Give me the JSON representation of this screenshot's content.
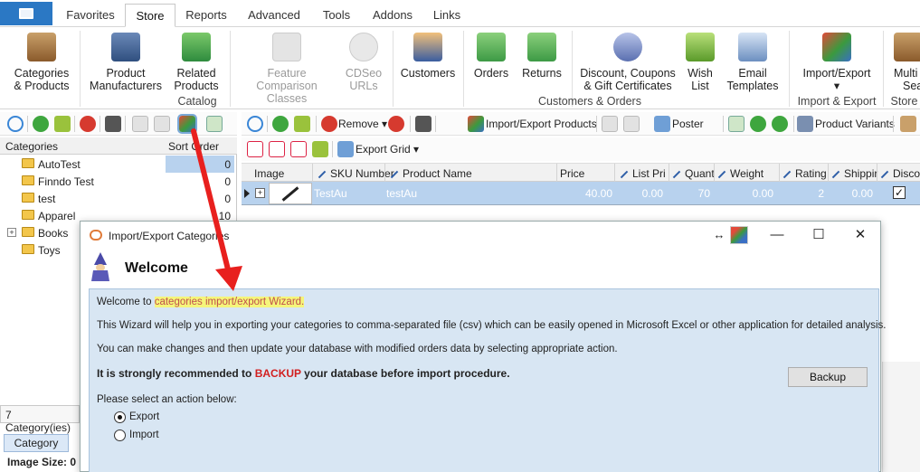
{
  "menu_tabs": [
    "Favorites",
    "Store",
    "Reports",
    "Advanced",
    "Tools",
    "Addons",
    "Links"
  ],
  "active_tab": "Store",
  "ribbon": {
    "buttons": [
      {
        "label1": "Categories",
        "label2": "& Products",
        "icon": "categories-products-icon",
        "enabled": true
      },
      {
        "label1": "Product",
        "label2": "Manufacturers",
        "icon": "manufacturers-icon",
        "enabled": true
      },
      {
        "label1": "Related",
        "label2": "Products",
        "icon": "related-products-icon",
        "enabled": true
      },
      {
        "label1": "Feature",
        "label2": "Comparison Classes",
        "icon": "feature-comparison-icon",
        "enabled": false
      },
      {
        "label1": "CDSeo",
        "label2": "URLs",
        "icon": "cdseo-icon",
        "enabled": false
      },
      {
        "label1": "Customers",
        "label2": "",
        "icon": "customers-icon",
        "enabled": true
      },
      {
        "label1": "Orders",
        "label2": "",
        "icon": "orders-icon",
        "enabled": true
      },
      {
        "label1": "Returns",
        "label2": "",
        "icon": "returns-icon",
        "enabled": true
      },
      {
        "label1": "Discount, Coupons",
        "label2": "& Gift Certificates",
        "icon": "discount-icon",
        "enabled": true
      },
      {
        "label1": "Wish",
        "label2": "List",
        "icon": "wishlist-icon",
        "enabled": true
      },
      {
        "label1": "Email",
        "label2": "Templates",
        "icon": "email-templates-icon",
        "enabled": true
      },
      {
        "label1": "Import/Export",
        "label2": "▾",
        "icon": "import-export-icon",
        "enabled": true
      },
      {
        "label1": "Multi",
        "label2": "Sea",
        "icon": "multi-store-icon",
        "enabled": true
      }
    ],
    "groups": [
      "Catalog",
      "Customers & Orders",
      "Import & Export",
      "Store"
    ]
  },
  "left_toolbar_icons": [
    "refresh-icon",
    "add-icon",
    "edit-icon",
    "delete-icon",
    "find-icon",
    "copy-icon",
    "paste-icon",
    "import-export-categories-icon",
    "add-subcategory-icon"
  ],
  "right_toolbar": {
    "remove_label": "Remove ▾",
    "import_export_label": "Import/Export Products",
    "poster_label": "Poster",
    "variants_label": "Product Variants",
    "export_grid_label": "Export Grid ▾"
  },
  "categories": {
    "header_name": "Categories",
    "header_sort": "Sort Order",
    "rows": [
      {
        "name": "AutoTest",
        "sort": "0",
        "expandable": false
      },
      {
        "name": "Finndo Test",
        "sort": "0",
        "expandable": false
      },
      {
        "name": "test",
        "sort": "0",
        "expandable": false
      },
      {
        "name": "Apparel",
        "sort": "10",
        "expandable": false
      },
      {
        "name": "Books",
        "sort": "",
        "expandable": true
      },
      {
        "name": "Toys",
        "sort": "",
        "expandable": false
      }
    ],
    "count_label": "7 Category(ies)",
    "tab_label": "Category",
    "image_size_label": "Image Size: 0"
  },
  "grid": {
    "columns": [
      "Image",
      "SKU Number",
      "Product Name",
      "Price",
      "List Pri",
      "Quant",
      "Weight",
      "Rating",
      "Shippir",
      "Discou"
    ],
    "row": {
      "sku": "TestAu",
      "name": "testAu",
      "price": "40.00",
      "list_price": "0.00",
      "quantity": "70",
      "weight": "0.00",
      "rating": "2",
      "shipping": "0.00",
      "discount_checked": true
    }
  },
  "dialog": {
    "title": "Import/Export Categories",
    "heading": "Welcome",
    "line1_prefix": "Welcome to ",
    "line1_highlight": "categories import/export Wizard.",
    "line2": "This Wizard will help you in exporting your categories to comma-separated file (csv) which can be easily opened in Microsoft Excel or other application for detailed analysis.",
    "line3": "You can make changes and then update your database with modified orders data by selecting appropriate action.",
    "warn_prefix": "It is strongly recommended to ",
    "warn_backup": "BACKUP",
    "warn_suffix": " your database before import procedure.",
    "backup_button": "Backup",
    "select_prompt": "Please select an action below:",
    "option_export": "Export",
    "option_import": "Import",
    "selected_option": "Export"
  },
  "colors": {
    "accent": "#2b78c4",
    "selection": "#b8d2ee",
    "highlight": "#f5f57a",
    "arrow": "#e8201e"
  }
}
